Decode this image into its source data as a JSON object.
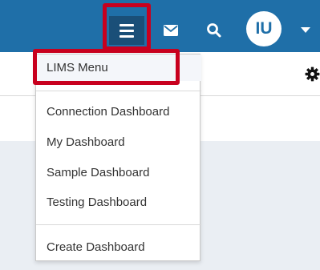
{
  "header": {
    "avatar_initials": "IU",
    "brand_color": "#1f6fa8",
    "menu_button_bg": "#1a4f78",
    "icons": [
      "hamburger-menu-icon",
      "envelope-icon",
      "search-icon",
      "chevron-down-icon",
      "gear-icon"
    ]
  },
  "dropdown": {
    "top_item": "LIMS Menu",
    "dashboards": [
      "Connection Dashboard",
      "My Dashboard",
      "Sample Dashboard",
      "Testing Dashboard"
    ],
    "create_item": "Create Dashboard"
  },
  "highlight_color": "#c8001e"
}
